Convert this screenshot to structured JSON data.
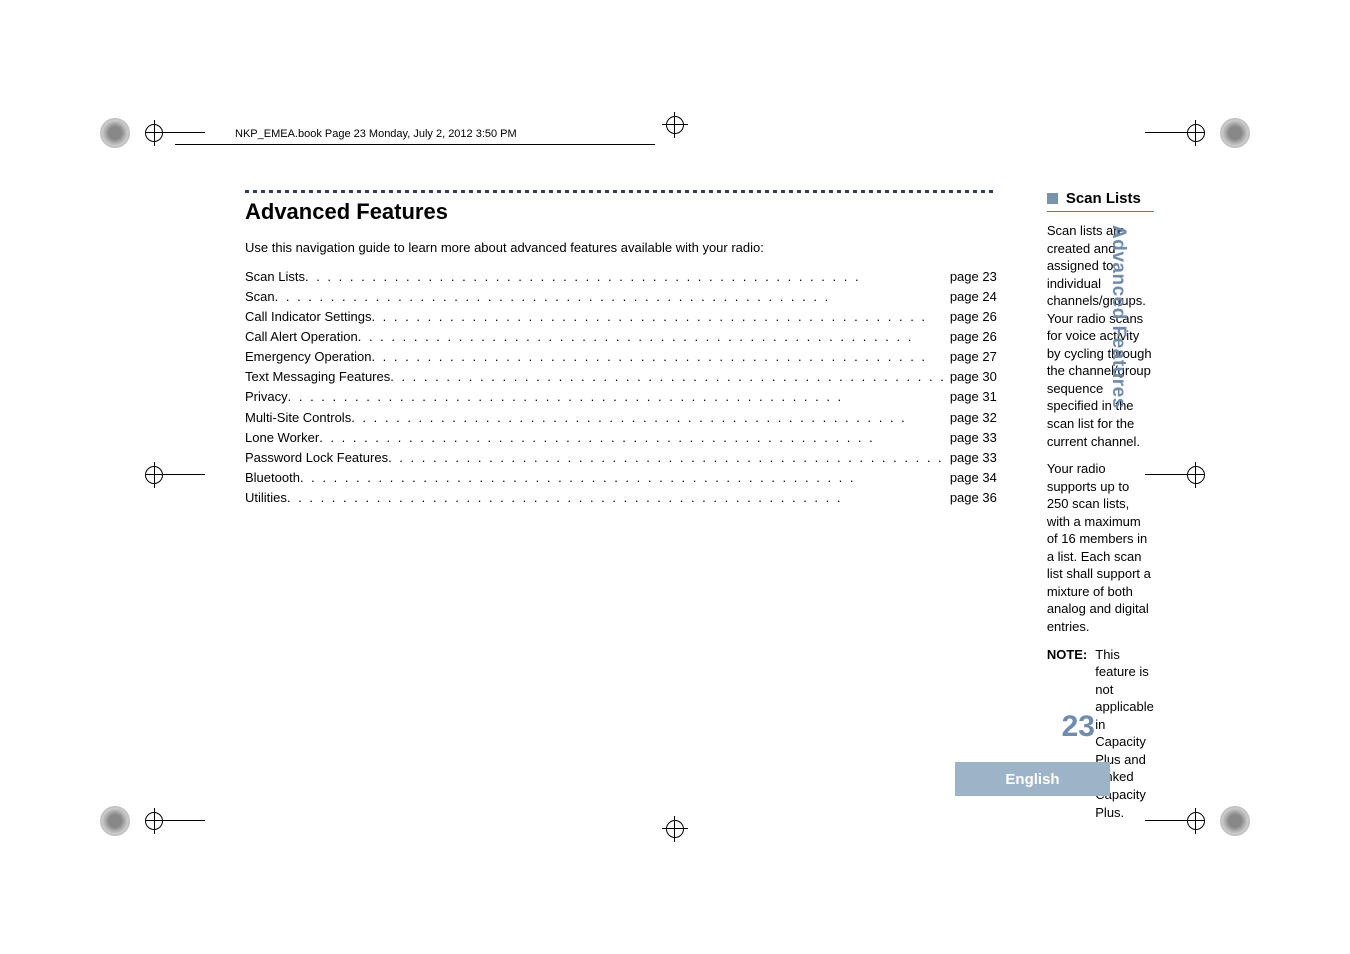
{
  "header_note": "NKP_EMEA.book  Page 23  Monday, July 2, 2012  3:50 PM",
  "chapter_title": "Advanced Features",
  "intro_text": "Use this navigation guide to learn more about advanced features available with your radio:",
  "toc": [
    {
      "label": "Scan Lists",
      "page": "page 23"
    },
    {
      "label": "Scan",
      "page": "page 24"
    },
    {
      "label": "Call Indicator Settings",
      "page": "page 26"
    },
    {
      "label": "Call Alert Operation",
      "page": "page 26"
    },
    {
      "label": "Emergency Operation",
      "page": "page 27"
    },
    {
      "label": "Text Messaging Features",
      "page": "page 30"
    },
    {
      "label": "Privacy",
      "page": "page 31"
    },
    {
      "label": "Multi-Site Controls",
      "page": "page 32"
    },
    {
      "label": "Lone Worker",
      "page": "page 33"
    },
    {
      "label": "Password Lock Features",
      "page": "page 33"
    },
    {
      "label": "Bluetooth",
      "page": "page 34"
    },
    {
      "label": "Utilities",
      "page": "page 36"
    }
  ],
  "section_title": "Scan Lists",
  "para1": "Scan lists are created and assigned to individual channels/groups. Your radio scans for voice activity by cycling through the channel/group sequence specified in the scan list for the current channel.",
  "para2": "Your radio supports up to 250 scan lists, with a maximum of 16 members in a list. Each scan list shall support a mixture of both analog and digital entries.",
  "note_label": "NOTE:",
  "note_text": "This feature is not applicable in Capacity Plus and Linked Capacity Plus.",
  "side_tab": "Advanced Features",
  "page_number": "23",
  "language": "English"
}
